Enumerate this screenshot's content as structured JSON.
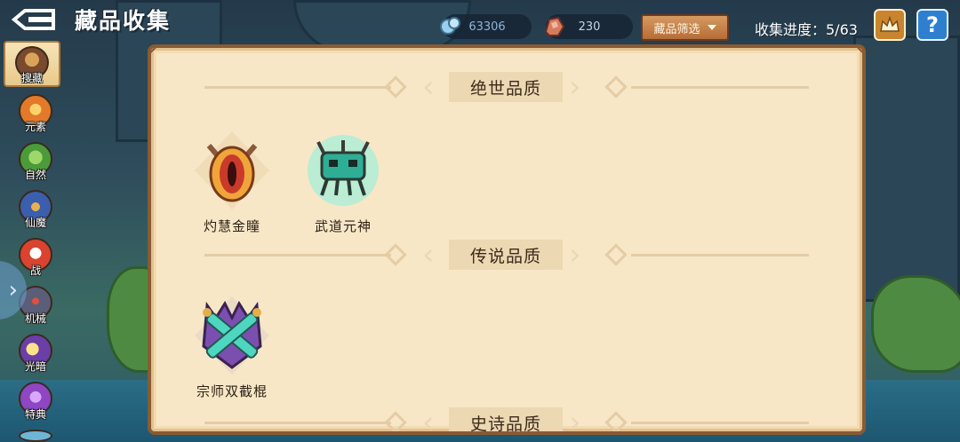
{
  "header": {
    "title": "藏品收集",
    "gems": "63306",
    "ore": "230",
    "filter_label": "藏品筛选",
    "progress_text": "收集进度：5/63",
    "help_label": "?"
  },
  "sidebar": {
    "items": [
      {
        "label": "搜藏",
        "icon": "hero-avatar-icon",
        "color": "#7a4a2e",
        "active": true
      },
      {
        "label": "元素",
        "icon": "fire-element-icon",
        "color": "#e27a2a"
      },
      {
        "label": "自然",
        "icon": "leaf-icon",
        "color": "#4c9b3a"
      },
      {
        "label": "仙魔",
        "icon": "demon-icon",
        "color": "#3b5fae"
      },
      {
        "label": "战",
        "icon": "battle-icon",
        "color": "#d8442f"
      },
      {
        "label": "机械",
        "icon": "mech-icon",
        "color": "#5a5e78"
      },
      {
        "label": "光暗",
        "icon": "light-dark-icon",
        "color": "#6b3ea8"
      },
      {
        "label": "特典",
        "icon": "special-icon",
        "color": "#8e46c2"
      }
    ]
  },
  "sections": [
    {
      "title": "绝世品质",
      "items": [
        {
          "name": "灼慧金瞳",
          "icon": "golden-eye-icon"
        },
        {
          "name": "武道元神",
          "icon": "jade-spirit-icon"
        }
      ]
    },
    {
      "title": "传说品质",
      "items": [
        {
          "name": "宗师双截棍",
          "icon": "crossed-nunchaku-icon"
        }
      ]
    },
    {
      "title": "史诗品质",
      "items": []
    }
  ],
  "colors": {
    "panel_bg": "#f7e7c7",
    "panel_border": "#8a5a33",
    "banner": "#ecd8b2",
    "filter_button": "#c98446",
    "help_button": "#2f7fd0"
  }
}
